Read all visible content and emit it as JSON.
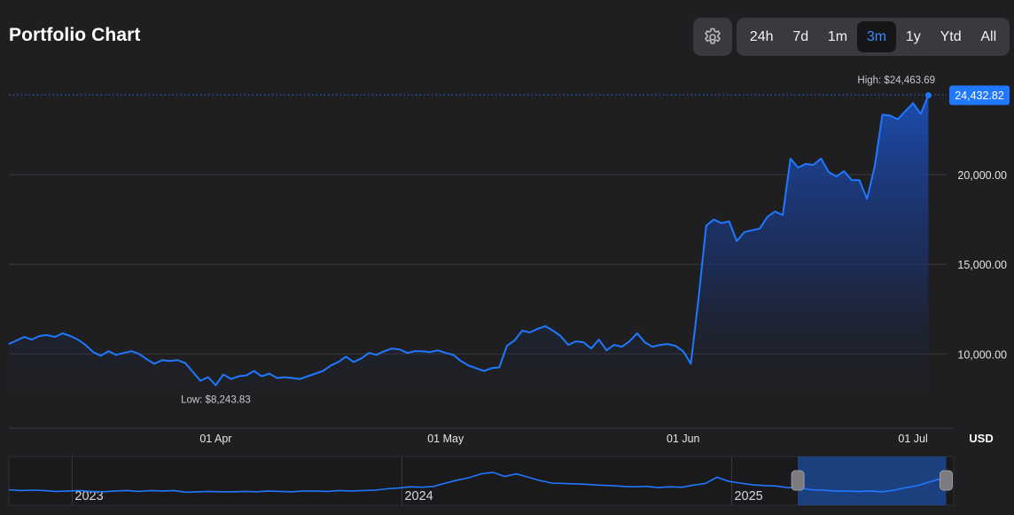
{
  "header": {
    "title": "Portfolio Chart",
    "settings_icon": "gear-icon",
    "ranges": [
      {
        "label": "24h",
        "active": false
      },
      {
        "label": "7d",
        "active": false
      },
      {
        "label": "1m",
        "active": false
      },
      {
        "label": "3m",
        "active": true
      },
      {
        "label": "1y",
        "active": false
      },
      {
        "label": "Ytd",
        "active": false
      },
      {
        "label": "All",
        "active": false
      }
    ]
  },
  "colors": {
    "background": "#1f1f21",
    "line": "#1f78ff",
    "active_range": "#3d8bff",
    "price_tag": "#1f78ff"
  },
  "chart_data": {
    "type": "area",
    "currency_label": "USD",
    "y_ticks": [
      "10,000.00",
      "15,000.00",
      "20,000.00"
    ],
    "y_tick_values": [
      10000,
      15000,
      20000
    ],
    "ylim": [
      6500,
      25300
    ],
    "x_ticks": [
      "01 Apr",
      "01 May",
      "01 Jun",
      "01 Jul"
    ],
    "x_tick_days": [
      27,
      57,
      88,
      118
    ],
    "xlim": [
      0,
      121
    ],
    "high_label": "High: $24,463.69",
    "high_value": 24463.69,
    "low_label": "Low: $8,243.83",
    "low_value": 8243.83,
    "current_label": "24,432.82",
    "current_value": 24432.82,
    "grid": true,
    "values": [
      10550,
      10750,
      10950,
      10800,
      11000,
      11050,
      10950,
      11150,
      11000,
      10800,
      10500,
      10100,
      9900,
      10150,
      9950,
      10050,
      10150,
      10000,
      9700,
      9450,
      9650,
      9600,
      9650,
      9500,
      9000,
      8500,
      8700,
      8250,
      8850,
      8600,
      8750,
      8800,
      9050,
      8750,
      8900,
      8650,
      8700,
      8650,
      8600,
      8750,
      8900,
      9050,
      9350,
      9550,
      9850,
      9550,
      9750,
      10050,
      9950,
      10150,
      10300,
      10250,
      10050,
      10150,
      10150,
      10100,
      10200,
      10050,
      9950,
      9600,
      9350,
      9200,
      9050,
      9200,
      9250,
      10450,
      10750,
      11300,
      11200,
      11400,
      11550,
      11300,
      11000,
      10500,
      10700,
      10650,
      10300,
      10800,
      10200,
      10500,
      10400,
      10700,
      11150,
      10650,
      10400,
      10500,
      10550,
      10450,
      10150,
      9450,
      13050,
      17150,
      17500,
      17300,
      17400,
      16300,
      16800,
      16900,
      17000,
      17650,
      17950,
      17750,
      20900,
      20400,
      20600,
      20550,
      20900,
      20150,
      19900,
      20200,
      19700,
      19700,
      18650,
      20450,
      23350,
      23300,
      23100,
      23550,
      24000,
      23400,
      24433
    ]
  },
  "navigator": {
    "year_labels": [
      "2023",
      "2024",
      "2025"
    ],
    "year_positions": [
      0.067,
      0.416,
      0.765
    ],
    "window_start": 0.835,
    "window_end": 0.992,
    "values": [
      0.33,
      0.31,
      0.32,
      0.31,
      0.29,
      0.3,
      0.31,
      0.29,
      0.28,
      0.3,
      0.31,
      0.29,
      0.31,
      0.3,
      0.31,
      0.27,
      0.28,
      0.29,
      0.28,
      0.28,
      0.29,
      0.28,
      0.3,
      0.29,
      0.28,
      0.3,
      0.3,
      0.29,
      0.31,
      0.3,
      0.31,
      0.32,
      0.35,
      0.37,
      0.4,
      0.39,
      0.41,
      0.49,
      0.56,
      0.62,
      0.71,
      0.75,
      0.65,
      0.71,
      0.63,
      0.55,
      0.49,
      0.48,
      0.47,
      0.46,
      0.44,
      0.43,
      0.41,
      0.4,
      0.41,
      0.38,
      0.4,
      0.39,
      0.44,
      0.48,
      0.63,
      0.53,
      0.49,
      0.45,
      0.43,
      0.42,
      0.38,
      0.37,
      0.33,
      0.32,
      0.3,
      0.3,
      0.29,
      0.3,
      0.28,
      0.32,
      0.38,
      0.43,
      0.52,
      0.6
    ]
  }
}
